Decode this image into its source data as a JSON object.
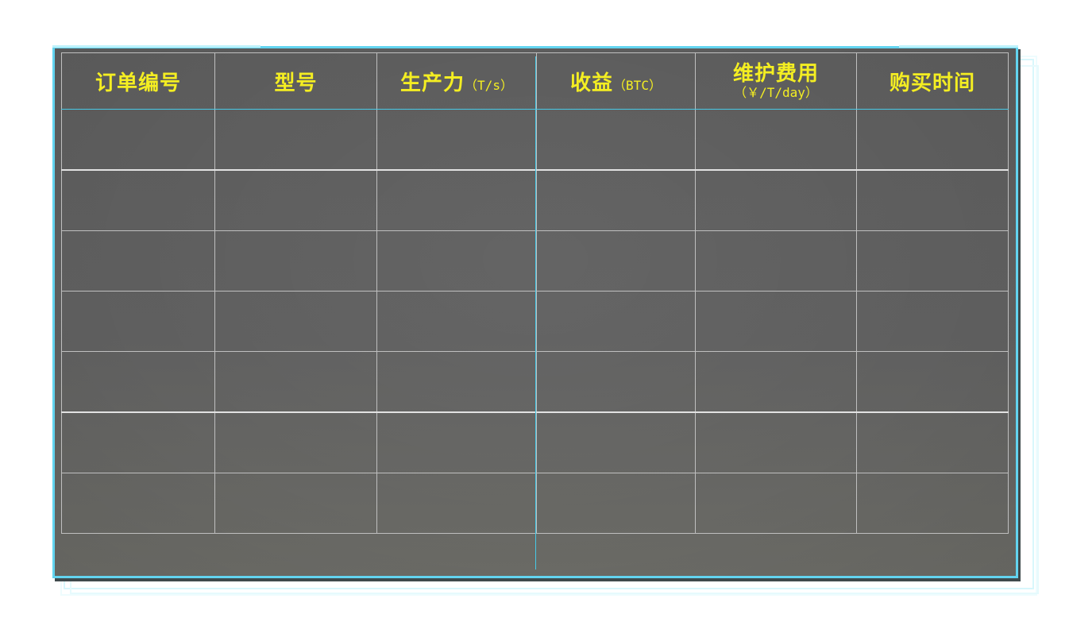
{
  "table": {
    "headers": [
      {
        "label": "订单编号",
        "unit": ""
      },
      {
        "label": "型号",
        "unit": ""
      },
      {
        "label": "生产力",
        "unit": "（T/s）"
      },
      {
        "label": "收益",
        "unit": "（BTC）"
      },
      {
        "label": "维护费用",
        "unit": "（￥/T/day）"
      },
      {
        "label": "购买时间",
        "unit": ""
      }
    ],
    "rows": [
      [
        "",
        "",
        "",
        "",
        "",
        ""
      ],
      [
        "",
        "",
        "",
        "",
        "",
        ""
      ],
      [
        "",
        "",
        "",
        "",
        "",
        ""
      ],
      [
        "",
        "",
        "",
        "",
        "",
        ""
      ],
      [
        "",
        "",
        "",
        "",
        "",
        ""
      ],
      [
        "",
        "",
        "",
        "",
        "",
        ""
      ],
      [
        "",
        "",
        "",
        "",
        "",
        ""
      ]
    ]
  },
  "colors": {
    "header_text": "#f4ee22",
    "frame": "#62d4f0",
    "panel": "#5f5f5f",
    "grid_line": "#bfbfbf"
  }
}
